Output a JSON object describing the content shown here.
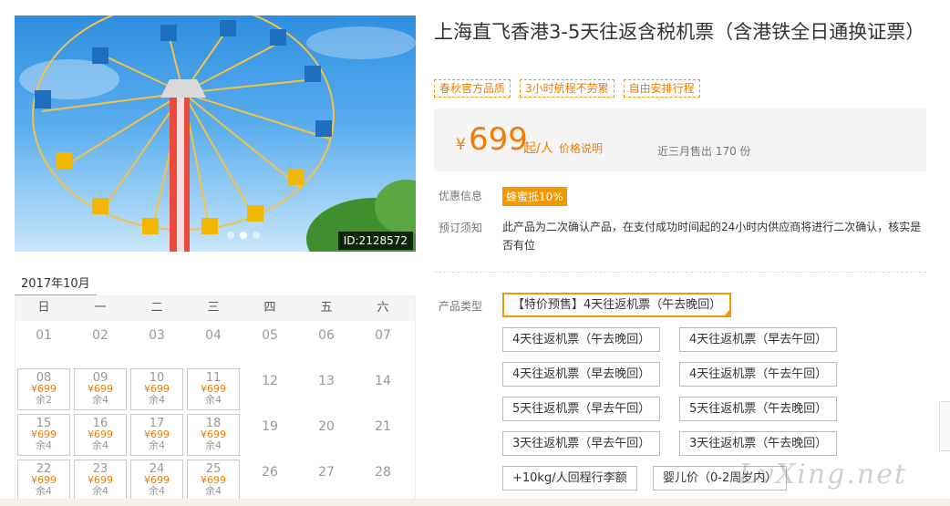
{
  "hero": {
    "image_icon": "ferris-swing-ride-image",
    "id_label": "ID:2128572",
    "dots": 3,
    "active_dot": 1
  },
  "calendar": {
    "month": "2017年10月",
    "weekdays": [
      "日",
      "一",
      "二",
      "三",
      "四",
      "五",
      "六"
    ],
    "rows": [
      [
        {
          "d": "01"
        },
        {
          "d": "02"
        },
        {
          "d": "03"
        },
        {
          "d": "04"
        },
        {
          "d": "05"
        },
        {
          "d": "06"
        },
        {
          "d": "07"
        }
      ],
      [
        {
          "d": "08",
          "p": "¥699",
          "r": "余2"
        },
        {
          "d": "09",
          "p": "¥699",
          "r": "余4"
        },
        {
          "d": "10",
          "p": "¥699",
          "r": "余4"
        },
        {
          "d": "11",
          "p": "¥699",
          "r": "余4"
        },
        {
          "d": "12"
        },
        {
          "d": "13"
        },
        {
          "d": "14"
        }
      ],
      [
        {
          "d": "15",
          "p": "¥699",
          "r": "余4"
        },
        {
          "d": "16",
          "p": "¥699",
          "r": "余4"
        },
        {
          "d": "17",
          "p": "¥699",
          "r": "余4"
        },
        {
          "d": "18",
          "p": "¥699",
          "r": "余4"
        },
        {
          "d": "19"
        },
        {
          "d": "20"
        },
        {
          "d": "21"
        }
      ],
      [
        {
          "d": "22",
          "p": "¥699",
          "r": "余4"
        },
        {
          "d": "23",
          "p": "¥699",
          "r": "余4"
        },
        {
          "d": "24",
          "p": "¥699",
          "r": "余4"
        },
        {
          "d": "25",
          "p": "¥699",
          "r": "余4"
        },
        {
          "d": "26"
        },
        {
          "d": "27"
        },
        {
          "d": "28"
        }
      ]
    ]
  },
  "product": {
    "title": "上海直飞香港3-5天往返含税机票（含港铁全日通换证票）",
    "tags": [
      "春秋官方品质",
      "3小时航程不劳累",
      "自由安排行程"
    ],
    "price": {
      "currency": "¥",
      "value": "699",
      "unit": "起/人",
      "note": "价格说明",
      "sold": "近三月售出 170 份"
    },
    "promo_label": "优惠信息",
    "promo_badge": "蜂蜜抵10%",
    "notice_label": "预订须知",
    "notice_text": "此产品为二次确认产品，在支付成功时间起的24小时内供应商将进行二次确认，核实是否有位",
    "type_label": "产品类型",
    "options": [
      {
        "label": "【特价预售】4天往返机票（午去晚回）",
        "selected": true
      },
      {
        "label": "4天往返机票（午去晚回）"
      },
      {
        "label": "4天往返机票（早去午回）"
      },
      {
        "label": "4天往返机票（早去晚回）"
      },
      {
        "label": "4天往返机票（午去午回）"
      },
      {
        "label": "5天往返机票（早去午回）"
      },
      {
        "label": "5天往返机票（午去晚回）"
      },
      {
        "label": "3天往返机票（早去午回）"
      },
      {
        "label": "3天往返机票（午去晚回）"
      },
      {
        "label": "+10kg/人回程行李额"
      },
      {
        "label": "婴儿价（0-2周岁内）"
      }
    ]
  },
  "watermark": "LvXing.net",
  "colors": {
    "accent": "#f39800",
    "price": "#f27c00"
  }
}
